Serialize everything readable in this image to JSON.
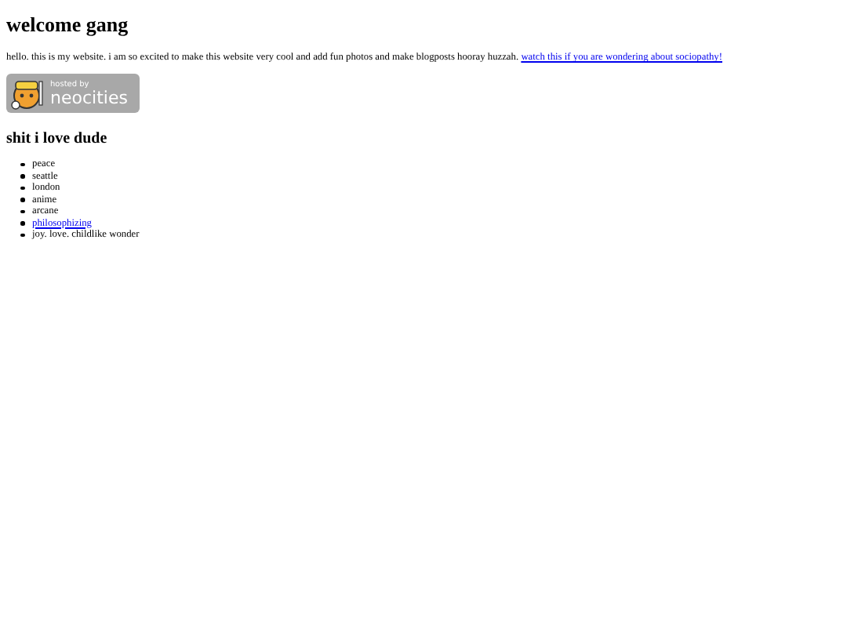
{
  "title": "welcome gang",
  "intro": {
    "text": "hello. this is my website. i am so excited to make this website very cool and add fun photos and make blogposts hooray huzzah.",
    "link": "watch this if you are wondering about sociopathy!"
  },
  "badge": {
    "caption": "hosted by",
    "brand": "neocities"
  },
  "list_heading": "shit i love dude",
  "list": [
    {
      "text": "peace",
      "kind": "plain"
    },
    {
      "text": "seattle",
      "kind": "plain"
    },
    {
      "text": "london",
      "kind": "plain"
    },
    {
      "text": "anime",
      "kind": "plain"
    },
    {
      "text": "arcane",
      "kind": "plain"
    },
    {
      "text": "philosophizing",
      "kind": "link"
    },
    {
      "text": "joy. love. childlike wonder",
      "kind": "plain"
    }
  ]
}
